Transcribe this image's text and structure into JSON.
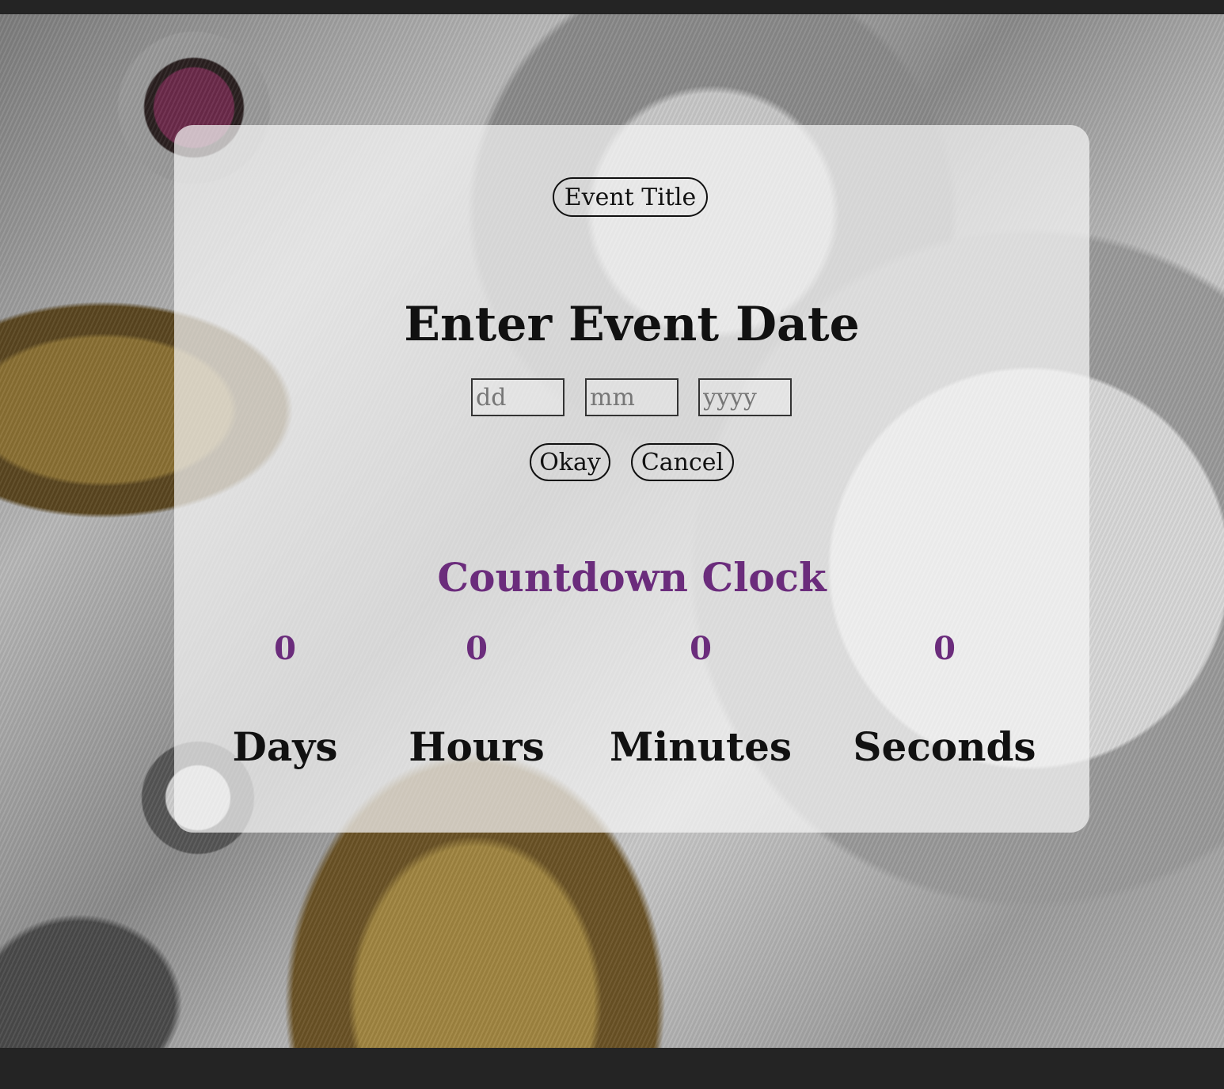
{
  "event_title_button": "Event Title",
  "heading": "Enter Event Date",
  "date_inputs": {
    "day_placeholder": "dd",
    "month_placeholder": "mm",
    "year_placeholder": "yyyy"
  },
  "buttons": {
    "okay": "Okay",
    "cancel": "Cancel"
  },
  "countdown": {
    "title": "Countdown Clock",
    "units": [
      {
        "value": "0",
        "label": "Days"
      },
      {
        "value": "0",
        "label": "Hours"
      },
      {
        "value": "0",
        "label": "Minutes"
      },
      {
        "value": "0",
        "label": "Seconds"
      }
    ]
  },
  "colors": {
    "accent": "#6b2c7c",
    "text": "#111111",
    "page_frame": "#242424"
  }
}
